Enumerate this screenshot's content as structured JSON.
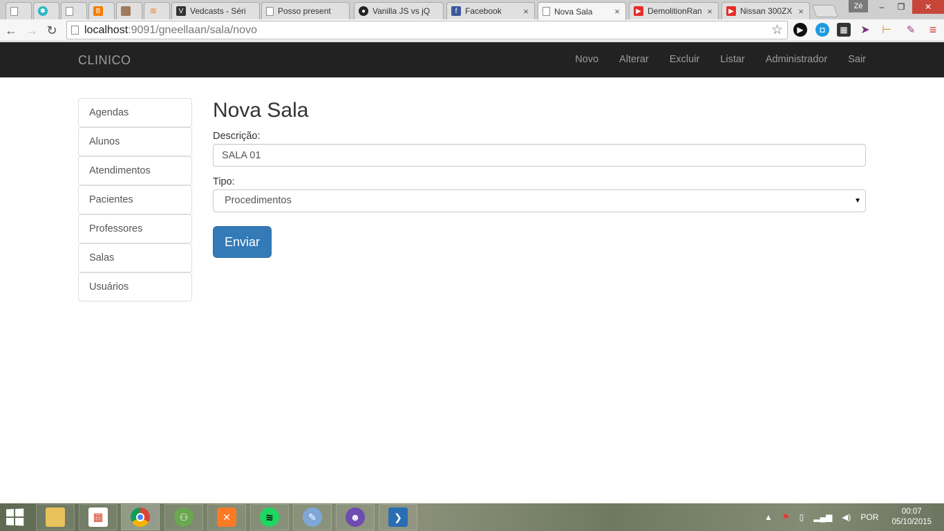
{
  "browser": {
    "tabs": [
      {
        "label": "",
        "icon": "page-icon",
        "active": false
      },
      {
        "label": "",
        "icon": "snowflake-icon",
        "active": false
      },
      {
        "label": "",
        "icon": "page-icon",
        "active": false
      },
      {
        "label": "",
        "icon": "blogger-icon",
        "active": false
      },
      {
        "label": "",
        "icon": "avatar-icon",
        "active": false
      },
      {
        "label": "",
        "icon": "stackoverflow-icon",
        "active": false
      },
      {
        "label": "Vedcasts - Séri",
        "icon": "vedcasts-icon",
        "active": false
      },
      {
        "label": "Posso present",
        "icon": "page-icon",
        "active": false
      },
      {
        "label": "Vanilla JS vs jQ",
        "icon": "github-icon",
        "active": false
      },
      {
        "label": "Facebook",
        "icon": "facebook-icon",
        "active": false
      },
      {
        "label": "Nova Sala",
        "icon": "page-icon",
        "active": true
      },
      {
        "label": "DemolitionRan",
        "icon": "youtube-icon",
        "active": false
      },
      {
        "label": "Nissan 300ZX |",
        "icon": "youtube-icon",
        "active": false
      }
    ],
    "tab_close": "×",
    "profile": "Zé",
    "window_controls": {
      "minimize": "–",
      "restore": "❐",
      "close": "✕"
    },
    "nav": {
      "back": "←",
      "forward": "→",
      "reload": "↻",
      "star": "☆"
    },
    "url_host": "localhost",
    "url_rest": ":9091/gneellaan/sala/novo"
  },
  "navbar": {
    "brand": "CLINICO",
    "links": [
      "Novo",
      "Alterar",
      "Excluir",
      "Listar",
      "Administrador",
      "Sair"
    ]
  },
  "sidebar": {
    "items": [
      "Agendas",
      "Alunos",
      "Atendimentos",
      "Pacientes",
      "Professores",
      "Salas",
      "Usuários"
    ]
  },
  "form": {
    "title": "Nova Sala",
    "descricao_label": "Descrição:",
    "descricao_value": "SALA 01",
    "tipo_label": "Tipo:",
    "tipo_value": "Procedimentos",
    "submit_label": "Enviar"
  },
  "taskbar": {
    "apps": [
      "file-explorer",
      "apps-grid",
      "chrome",
      "pong",
      "xampp",
      "spotify",
      "paint",
      "github-desktop",
      "powershell"
    ],
    "language": "POR",
    "time": "00:07",
    "date": "05/10/2015"
  },
  "colors": {
    "navbar_bg": "#222222",
    "primary_button": "#337ab7",
    "nav_link": "#9d9d9d"
  }
}
